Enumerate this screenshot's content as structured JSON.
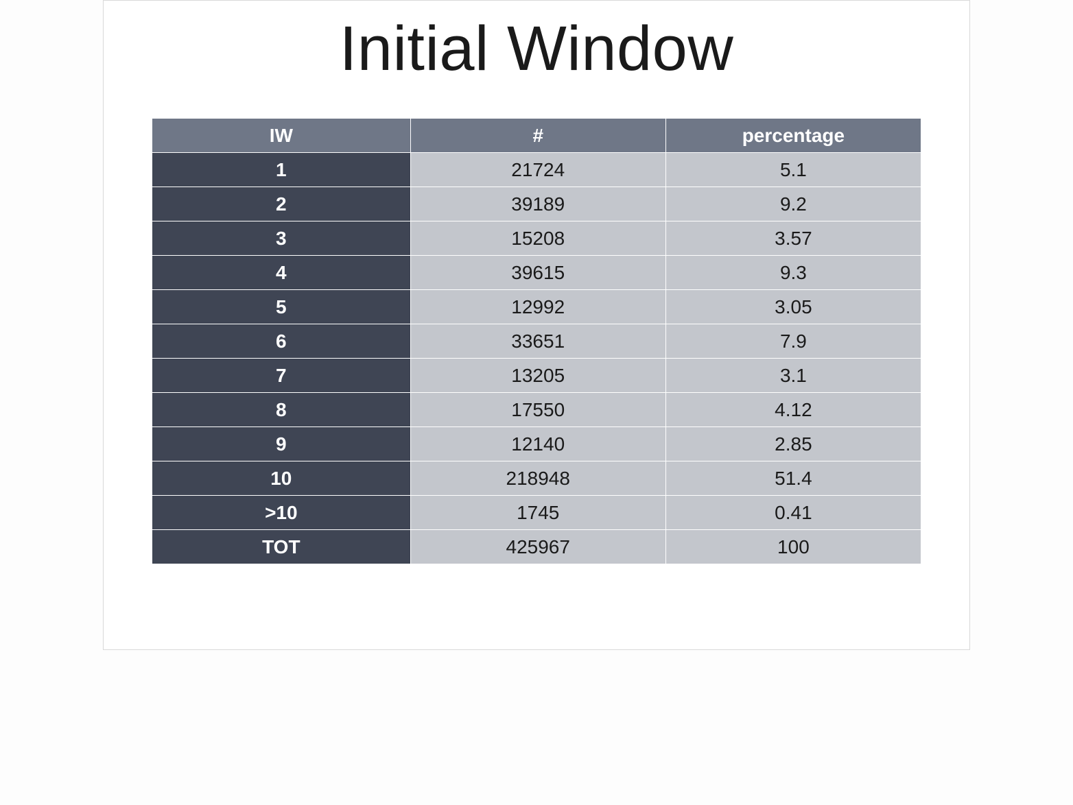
{
  "title": "Initial Window",
  "columns": {
    "c1": "IW",
    "c2": "#",
    "c3": "percentage"
  },
  "rows": [
    {
      "iw": "1",
      "count": "21724",
      "pct": "5.1"
    },
    {
      "iw": "2",
      "count": "39189",
      "pct": "9.2"
    },
    {
      "iw": "3",
      "count": "15208",
      "pct": "3.57"
    },
    {
      "iw": "4",
      "count": "39615",
      "pct": "9.3"
    },
    {
      "iw": "5",
      "count": "12992",
      "pct": "3.05"
    },
    {
      "iw": "6",
      "count": "33651",
      "pct": "7.9"
    },
    {
      "iw": "7",
      "count": "13205",
      "pct": "3.1"
    },
    {
      "iw": "8",
      "count": "17550",
      "pct": "4.12"
    },
    {
      "iw": "9",
      "count": "12140",
      "pct": "2.85"
    },
    {
      "iw": "10",
      "count": "218948",
      "pct": "51.4"
    },
    {
      "iw": ">10",
      "count": "1745",
      "pct": "0.41"
    },
    {
      "iw": "TOT",
      "count": "425967",
      "pct": "100"
    }
  ],
  "chart_data": {
    "type": "table",
    "title": "Initial Window",
    "columns": [
      "IW",
      "#",
      "percentage"
    ],
    "rows": [
      [
        "1",
        21724,
        5.1
      ],
      [
        "2",
        39189,
        9.2
      ],
      [
        "3",
        15208,
        3.57
      ],
      [
        "4",
        39615,
        9.3
      ],
      [
        "5",
        12992,
        3.05
      ],
      [
        "6",
        33651,
        7.9
      ],
      [
        "7",
        13205,
        3.1
      ],
      [
        "8",
        17550,
        4.12
      ],
      [
        "9",
        12140,
        2.85
      ],
      [
        "10",
        218948,
        51.4
      ],
      [
        ">10",
        1745,
        0.41
      ],
      [
        "TOT",
        425967,
        100
      ]
    ]
  }
}
